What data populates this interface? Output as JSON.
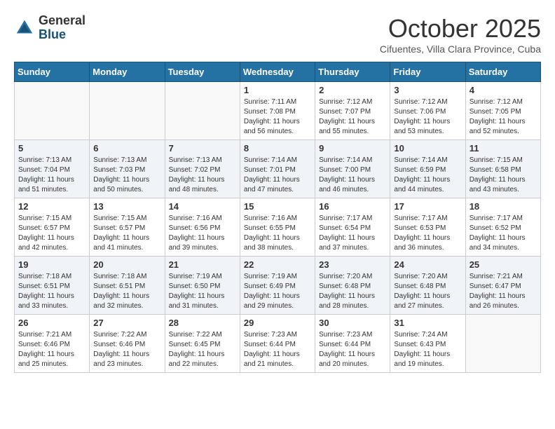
{
  "header": {
    "logo_general": "General",
    "logo_blue": "Blue",
    "month_title": "October 2025",
    "subtitle": "Cifuentes, Villa Clara Province, Cuba"
  },
  "calendar": {
    "days_of_week": [
      "Sunday",
      "Monday",
      "Tuesday",
      "Wednesday",
      "Thursday",
      "Friday",
      "Saturday"
    ],
    "weeks": [
      [
        {
          "day": "",
          "info": ""
        },
        {
          "day": "",
          "info": ""
        },
        {
          "day": "",
          "info": ""
        },
        {
          "day": "1",
          "info": "Sunrise: 7:11 AM\nSunset: 7:08 PM\nDaylight: 11 hours and 56 minutes."
        },
        {
          "day": "2",
          "info": "Sunrise: 7:12 AM\nSunset: 7:07 PM\nDaylight: 11 hours and 55 minutes."
        },
        {
          "day": "3",
          "info": "Sunrise: 7:12 AM\nSunset: 7:06 PM\nDaylight: 11 hours and 53 minutes."
        },
        {
          "day": "4",
          "info": "Sunrise: 7:12 AM\nSunset: 7:05 PM\nDaylight: 11 hours and 52 minutes."
        }
      ],
      [
        {
          "day": "5",
          "info": "Sunrise: 7:13 AM\nSunset: 7:04 PM\nDaylight: 11 hours and 51 minutes."
        },
        {
          "day": "6",
          "info": "Sunrise: 7:13 AM\nSunset: 7:03 PM\nDaylight: 11 hours and 50 minutes."
        },
        {
          "day": "7",
          "info": "Sunrise: 7:13 AM\nSunset: 7:02 PM\nDaylight: 11 hours and 48 minutes."
        },
        {
          "day": "8",
          "info": "Sunrise: 7:14 AM\nSunset: 7:01 PM\nDaylight: 11 hours and 47 minutes."
        },
        {
          "day": "9",
          "info": "Sunrise: 7:14 AM\nSunset: 7:00 PM\nDaylight: 11 hours and 46 minutes."
        },
        {
          "day": "10",
          "info": "Sunrise: 7:14 AM\nSunset: 6:59 PM\nDaylight: 11 hours and 44 minutes."
        },
        {
          "day": "11",
          "info": "Sunrise: 7:15 AM\nSunset: 6:58 PM\nDaylight: 11 hours and 43 minutes."
        }
      ],
      [
        {
          "day": "12",
          "info": "Sunrise: 7:15 AM\nSunset: 6:57 PM\nDaylight: 11 hours and 42 minutes."
        },
        {
          "day": "13",
          "info": "Sunrise: 7:15 AM\nSunset: 6:57 PM\nDaylight: 11 hours and 41 minutes."
        },
        {
          "day": "14",
          "info": "Sunrise: 7:16 AM\nSunset: 6:56 PM\nDaylight: 11 hours and 39 minutes."
        },
        {
          "day": "15",
          "info": "Sunrise: 7:16 AM\nSunset: 6:55 PM\nDaylight: 11 hours and 38 minutes."
        },
        {
          "day": "16",
          "info": "Sunrise: 7:17 AM\nSunset: 6:54 PM\nDaylight: 11 hours and 37 minutes."
        },
        {
          "day": "17",
          "info": "Sunrise: 7:17 AM\nSunset: 6:53 PM\nDaylight: 11 hours and 36 minutes."
        },
        {
          "day": "18",
          "info": "Sunrise: 7:17 AM\nSunset: 6:52 PM\nDaylight: 11 hours and 34 minutes."
        }
      ],
      [
        {
          "day": "19",
          "info": "Sunrise: 7:18 AM\nSunset: 6:51 PM\nDaylight: 11 hours and 33 minutes."
        },
        {
          "day": "20",
          "info": "Sunrise: 7:18 AM\nSunset: 6:51 PM\nDaylight: 11 hours and 32 minutes."
        },
        {
          "day": "21",
          "info": "Sunrise: 7:19 AM\nSunset: 6:50 PM\nDaylight: 11 hours and 31 minutes."
        },
        {
          "day": "22",
          "info": "Sunrise: 7:19 AM\nSunset: 6:49 PM\nDaylight: 11 hours and 29 minutes."
        },
        {
          "day": "23",
          "info": "Sunrise: 7:20 AM\nSunset: 6:48 PM\nDaylight: 11 hours and 28 minutes."
        },
        {
          "day": "24",
          "info": "Sunrise: 7:20 AM\nSunset: 6:48 PM\nDaylight: 11 hours and 27 minutes."
        },
        {
          "day": "25",
          "info": "Sunrise: 7:21 AM\nSunset: 6:47 PM\nDaylight: 11 hours and 26 minutes."
        }
      ],
      [
        {
          "day": "26",
          "info": "Sunrise: 7:21 AM\nSunset: 6:46 PM\nDaylight: 11 hours and 25 minutes."
        },
        {
          "day": "27",
          "info": "Sunrise: 7:22 AM\nSunset: 6:46 PM\nDaylight: 11 hours and 23 minutes."
        },
        {
          "day": "28",
          "info": "Sunrise: 7:22 AM\nSunset: 6:45 PM\nDaylight: 11 hours and 22 minutes."
        },
        {
          "day": "29",
          "info": "Sunrise: 7:23 AM\nSunset: 6:44 PM\nDaylight: 11 hours and 21 minutes."
        },
        {
          "day": "30",
          "info": "Sunrise: 7:23 AM\nSunset: 6:44 PM\nDaylight: 11 hours and 20 minutes."
        },
        {
          "day": "31",
          "info": "Sunrise: 7:24 AM\nSunset: 6:43 PM\nDaylight: 11 hours and 19 minutes."
        },
        {
          "day": "",
          "info": ""
        }
      ]
    ]
  }
}
